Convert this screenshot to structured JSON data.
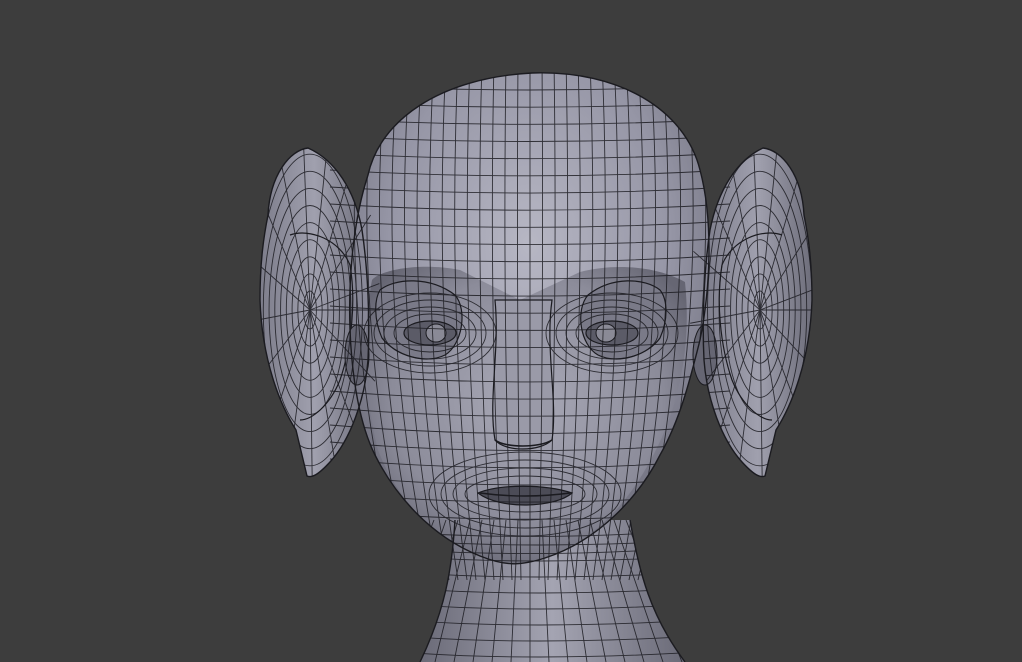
{
  "viewport": {
    "background": "#3d3d3d",
    "display_mode": "solid-wireframe-overlay",
    "object": "head-mesh"
  },
  "mesh": {
    "surface_color": "#8e8e9e",
    "surface_highlight": "#b7b7c4",
    "surface_shadow": "#5c5c68",
    "wire_color": "#1b1b20"
  }
}
